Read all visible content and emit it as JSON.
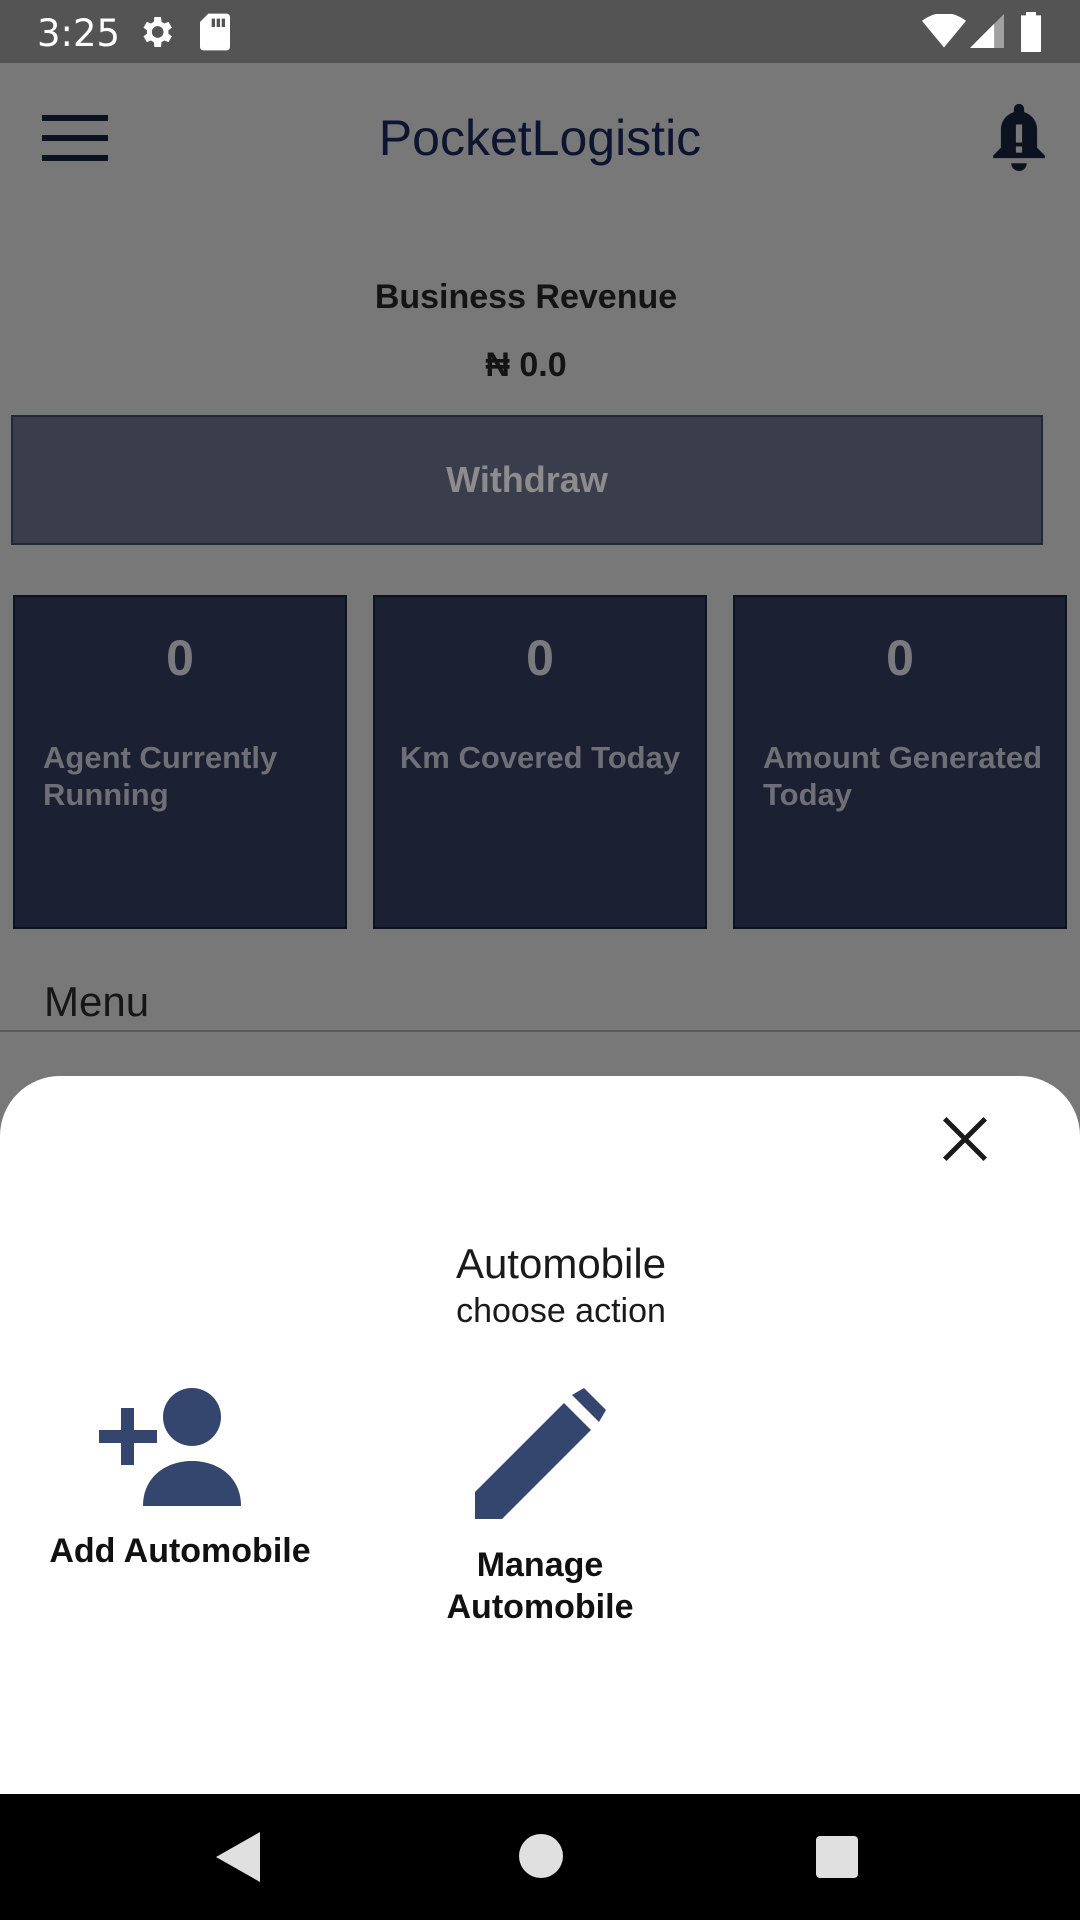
{
  "status_bar": {
    "time": "3:25",
    "icons": [
      "gear-icon",
      "sd-card-icon",
      "wifi-icon",
      "cell-signal-icon",
      "battery-icon"
    ]
  },
  "app_bar": {
    "title": "PocketLogistic",
    "menu_icon": "hamburger-icon",
    "notification_icon": "bell-icon"
  },
  "revenue": {
    "label": "Business Revenue",
    "value": "₦ 0.0",
    "withdraw_label": "Withdraw"
  },
  "stats": [
    {
      "value": "0",
      "label": "Agent Currently Running"
    },
    {
      "value": "0",
      "label": "Km Covered Today"
    },
    {
      "value": "0",
      "label": "Amount Generated Today"
    }
  ],
  "menu": {
    "label": "Menu"
  },
  "sheet": {
    "title": "Automobile",
    "subtitle": "choose action",
    "actions": [
      {
        "label": "Add Automobile",
        "icon": "add-person-icon"
      },
      {
        "label": "Manage Automobile",
        "icon": "pencil-icon"
      }
    ]
  },
  "colors": {
    "overlay": "#787878",
    "card_bg": "#1b2033",
    "icon_accent": "#34466d",
    "status_bar": "#545454"
  }
}
